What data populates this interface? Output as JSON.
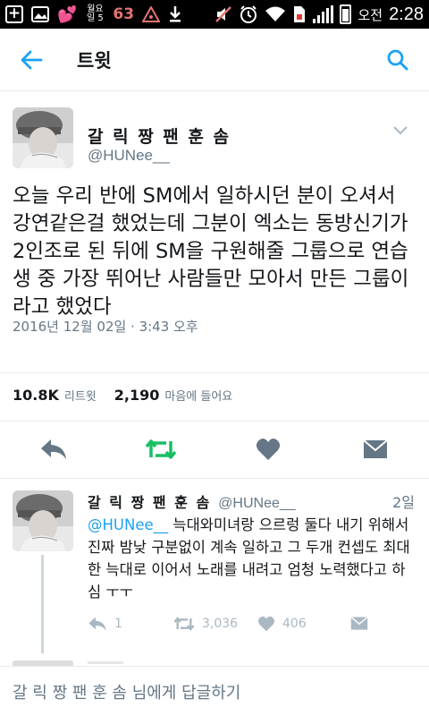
{
  "status_bar": {
    "icons": [
      "plus-box-icon",
      "gallery-icon",
      "heart-sticker-icon",
      "calendar-icon",
      "notification-63-icon",
      "warning-icon",
      "download-icon",
      "mute-icon",
      "alarm-icon",
      "wifi-icon",
      "sim-icon",
      "signal-icon",
      "battery-icon"
    ],
    "calendar_text": "월요일 5",
    "notification_count": "63",
    "ampm": "오전",
    "time": "2:28"
  },
  "appbar": {
    "title": "트윗"
  },
  "tweet": {
    "author_name": "갈 릭 짱 팬 훈 솜",
    "author_handle": "@HUNee__",
    "body": "오늘 우리 반에 SM에서 일하시던 분이 오셔서 강연같은걸 했었는데 그분이 엑소는 동방신기가 2인조로 된 뒤에 SM을 구원해줄 그룹으로 연습생 중 가장 뛰어난 사람들만 모아서 만든 그룹이라고 했었다",
    "date": "2016년 12월 02일 · 3:43 오후",
    "retweet_count": "10.8K",
    "retweet_label": "리트윗",
    "like_count": "2,190",
    "like_label": "마음에 들어요"
  },
  "reply_tweet": {
    "author_name": "갈 릭 짱 팬 훈 솜",
    "author_handle": "@HUNee__",
    "time": "2일",
    "mention": "@HUNee__",
    "body": " 늑대와미녀랑 으르렁 둘다 내기 위해서 진짜 밤낮 구분없이 계속 일하고 그 두개 컨셉도 최대한 늑대로 이어서 노래를 내려고 엄청 노력했다고 하심 ㅜㅜ",
    "reply_count": "1",
    "retweet_count": "3,036",
    "like_count": "406"
  },
  "reply_bar": {
    "placeholder": "갈 릭 짱 팬 훈 솜 님에게 답글하기"
  },
  "colors": {
    "accent": "#1da1f2",
    "retweet_green": "#17bf63",
    "icon_gray": "#657786",
    "light_gray": "#aab8c2"
  }
}
